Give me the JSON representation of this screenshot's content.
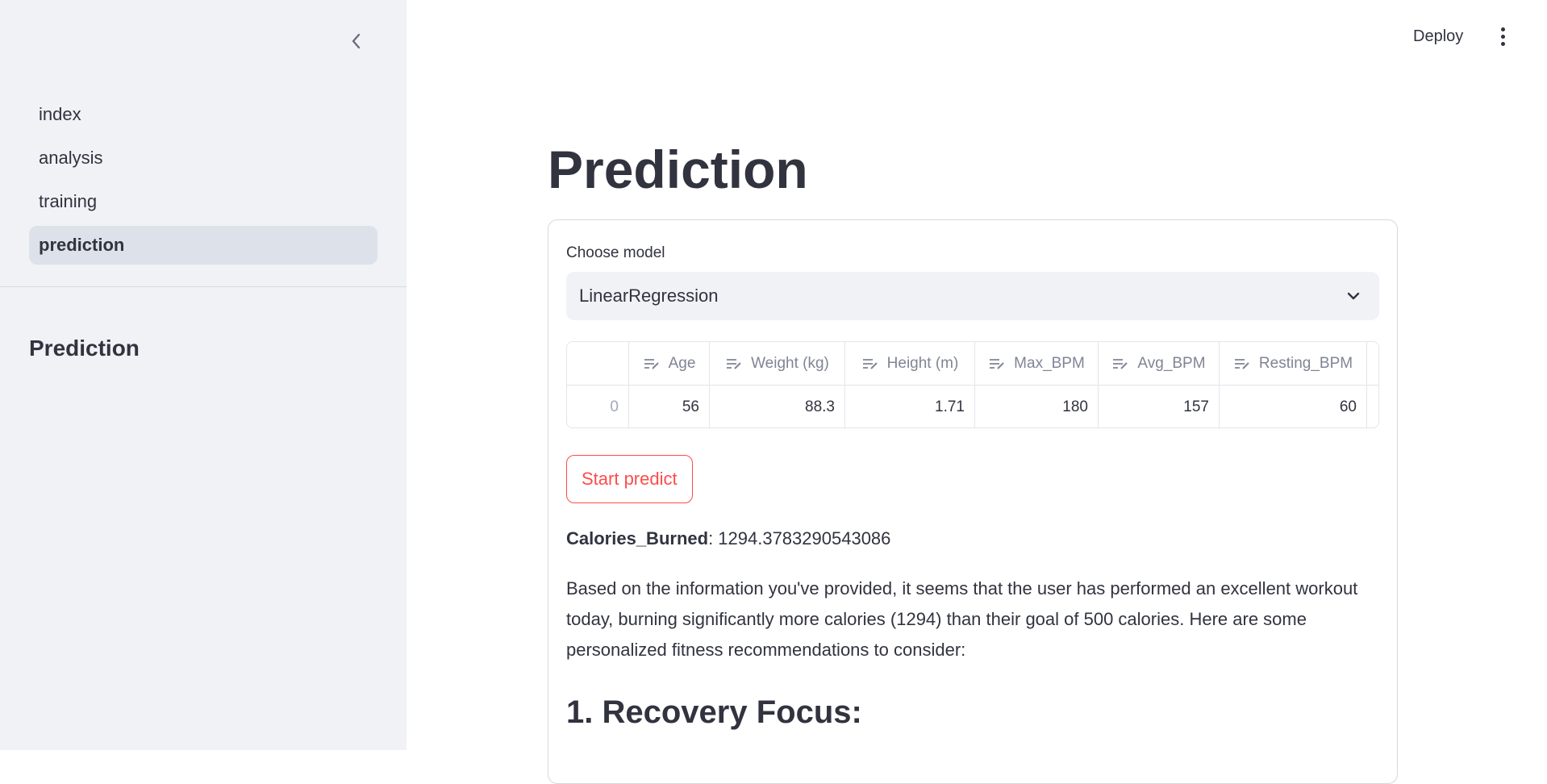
{
  "sidebar": {
    "collapse_icon": "chevron-left-icon",
    "nav": [
      "index",
      "analysis",
      "training",
      "prediction"
    ],
    "active": "prediction",
    "heading": "Prediction"
  },
  "header": {
    "deploy_label": "Deploy",
    "menu_icon": "kebab-menu-icon"
  },
  "main": {
    "title": "Prediction",
    "select": {
      "label": "Choose model",
      "value": "LinearRegression"
    },
    "table": {
      "columns": [
        "Age",
        "Weight (kg)",
        "Height (m)",
        "Max_BPM",
        "Avg_BPM",
        "Resting_BPM"
      ],
      "rows": [
        [
          "0",
          "56",
          "88.3",
          "1.71",
          "180",
          "157",
          "60"
        ]
      ]
    },
    "predict_button": "Start predict",
    "result_label": "Calories_Burned",
    "result_value": ": 1294.3783290543086",
    "paragraph": "Based on the information you've provided, it seems that the user has performed an excellent workout today, burning significantly more calories (1294) than their goal of 500 calories. Here are some personalized fitness recommendations to consider:",
    "subheading": "1. Recovery Focus:"
  },
  "colors": {
    "accent": "#ff4b4b",
    "sidebar_bg": "#f0f2f6",
    "text": "#31333f"
  }
}
